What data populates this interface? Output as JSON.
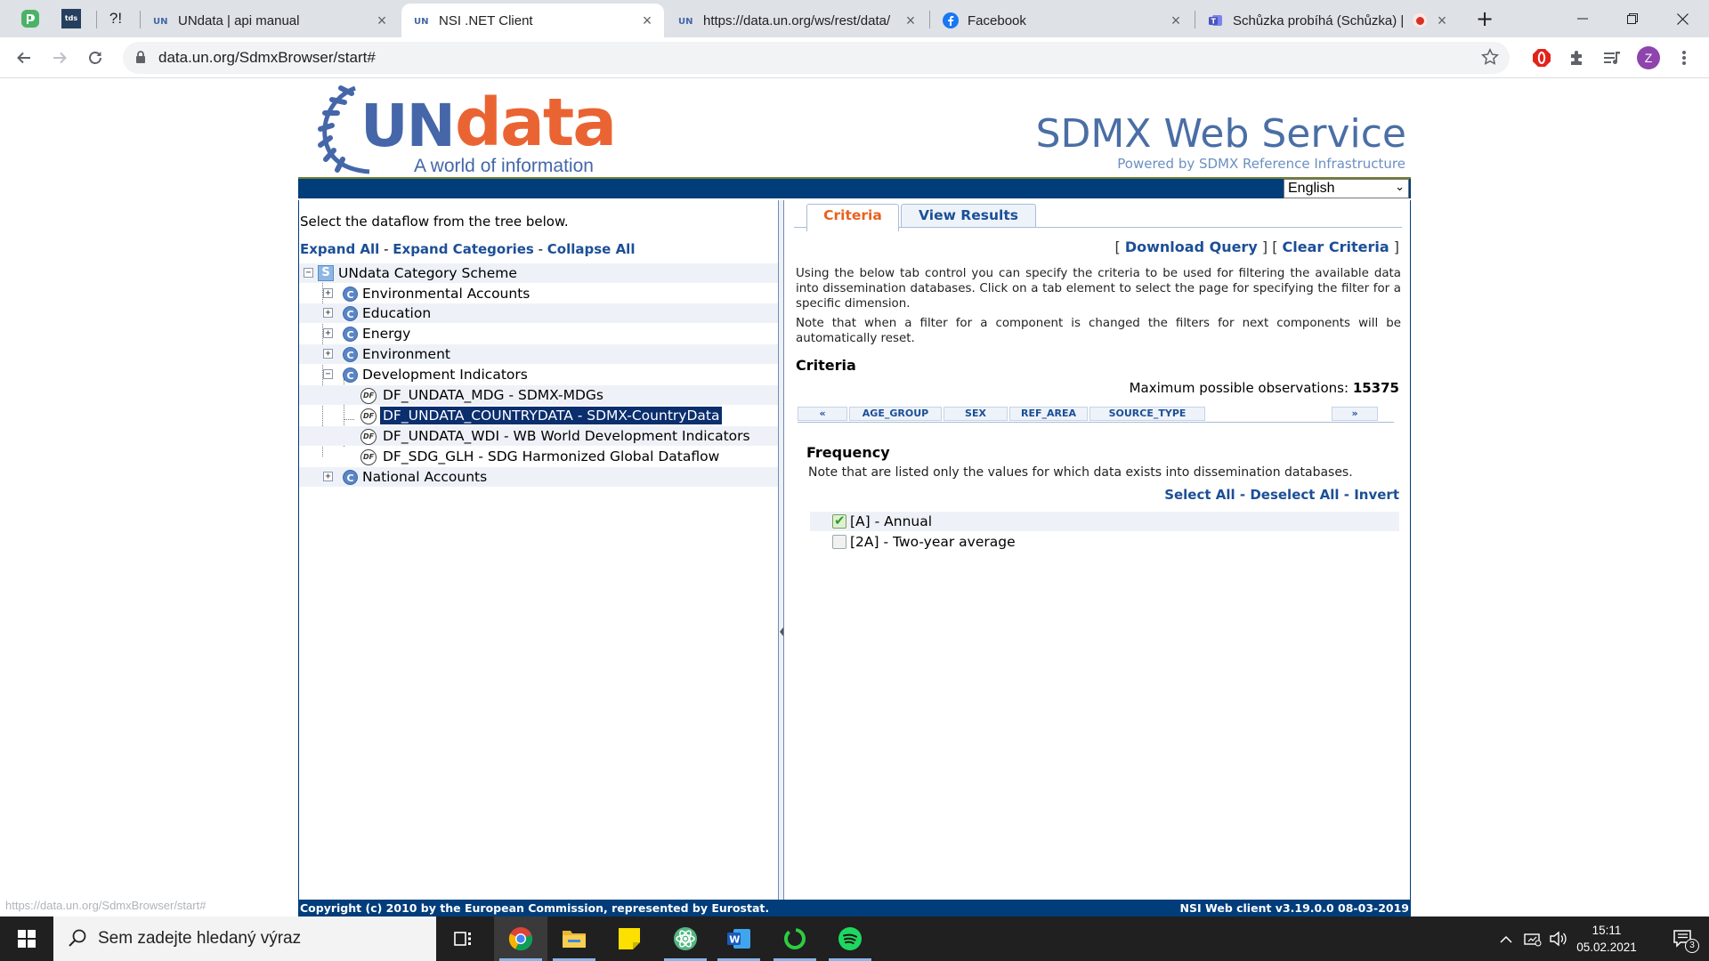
{
  "browser": {
    "pinned_tabs": [
      {
        "label": "",
        "icon": "pushbullet-icon"
      },
      {
        "label": "tds",
        "icon": "tds-icon"
      },
      {
        "label": "?!",
        "icon": "question-exclaim-icon"
      }
    ],
    "tabs": [
      {
        "title": "UNdata | api manual",
        "icon": "undata-favicon",
        "active": false
      },
      {
        "title": "NSI .NET Client",
        "icon": "undata-favicon",
        "active": true
      },
      {
        "title": "https://data.un.org/ws/rest/data/",
        "icon": "undata-favicon",
        "active": false
      },
      {
        "title": "Facebook",
        "icon": "facebook-icon",
        "active": false
      },
      {
        "title": "Schůzka probíhá (Schůzka) |",
        "icon": "teams-icon",
        "active": false,
        "recording": true
      }
    ],
    "new_tab_symbol": "+",
    "url": "data.un.org/SdmxBrowser/start#",
    "profile_initial": "Z",
    "status_url": "https://data.un.org/SdmxBrowser/start#"
  },
  "site": {
    "logo_un": "UN",
    "logo_data": "data",
    "logo_tagline": "A world of information",
    "title": "SDMX Web Service",
    "powered_by": "Powered by SDMX Reference Infrastructure",
    "language": "English",
    "footer_left": "Copyright (c) 2010 by the European Commission, represented by Eurostat.",
    "footer_right": "NSI Web client v3.19.0.0 08-03-2019"
  },
  "left": {
    "intro": "Select the dataflow from the tree below.",
    "expand_all": "Expand All",
    "expand_categories": "Expand Categories",
    "collapse_all": "Collapse All",
    "separator": " - ",
    "tree": {
      "root": "UNdata Category Scheme",
      "categories": [
        {
          "label": "Environmental Accounts",
          "expanded": false
        },
        {
          "label": "Education",
          "expanded": false
        },
        {
          "label": "Energy",
          "expanded": false
        },
        {
          "label": "Environment",
          "expanded": false
        },
        {
          "label": "Development Indicators",
          "expanded": true
        },
        {
          "label": "National Accounts",
          "expanded": false
        }
      ],
      "dataflows": [
        {
          "label": "DF_UNDATA_MDG - SDMX-MDGs",
          "selected": false
        },
        {
          "label": "DF_UNDATA_COUNTRYDATA - SDMX-CountryData",
          "selected": true
        },
        {
          "label": "DF_UNDATA_WDI - WB World Development Indicators",
          "selected": false
        },
        {
          "label": "DF_SDG_GLH - SDG Harmonized Global Dataflow",
          "selected": false
        }
      ]
    }
  },
  "right": {
    "tabs": [
      "Criteria",
      "View Results"
    ],
    "download_query": "Download Query",
    "clear_criteria": "Clear Criteria",
    "bracket_open": "[",
    "bracket_close": "]",
    "para1": "Using the below tab control you can specify the criteria to be used for filtering the available data into dissemination databases. Click on a tab element to select the page for specifying the filter for a specific dimension.",
    "para2": "Note that when a filter for a component is changed the filters for next components will be automatically reset.",
    "criteria_heading": "Criteria",
    "max_obs_label": "Maximum possible observations:",
    "max_obs_value": "15375",
    "dim_tabs": [
      "«",
      "AGE_GROUP",
      "SEX",
      "REF_AREA",
      "SOURCE_TYPE",
      "»"
    ],
    "frequency_heading": "Frequency",
    "frequency_note": "Note that are listed only the values for which data exists into dissemination databases.",
    "select_all": "Select All",
    "deselect_all": "Deselect All",
    "invert": "Invert",
    "options": [
      {
        "label": "[A] - Annual",
        "checked": true
      },
      {
        "label": "[2A] - Two-year average",
        "checked": false
      }
    ]
  },
  "taskbar": {
    "search_placeholder": "Sem zadejte hledaný výraz",
    "time": "15:11",
    "date": "05.02.2021",
    "notification_count": "3",
    "apps": [
      "task-view-icon",
      "chrome-icon",
      "file-explorer-icon",
      "sticky-notes-icon",
      "atom-icon",
      "word-icon",
      "circle-app-icon",
      "spotify-icon"
    ]
  },
  "colors": {
    "brand_blue": "#003d7a",
    "link_blue": "#1c4f96",
    "accent_orange": "#e8621d",
    "logo_blue": "#4567a9",
    "logo_orange": "#ea6433"
  }
}
